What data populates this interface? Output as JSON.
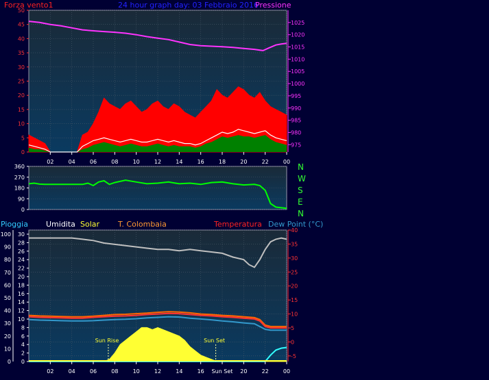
{
  "header": {
    "left_label": "Forza vento1",
    "title": "24 hour graph day: 03 Febbraio 2016",
    "right_label": "Pressione"
  },
  "bottom_header": {
    "pioggia": "Pioggia",
    "umidita": "Umidita",
    "solar": "Solar",
    "colombaia": "T. Colombaia",
    "temperatura": "Temperatura",
    "dewpoint": "Dew Point (°C)"
  },
  "x_ticks": [
    "02",
    "04",
    "06",
    "08",
    "10",
    "12",
    "14",
    "16",
    "18",
    "20",
    "22",
    "00"
  ],
  "bottom_x_ticks": [
    "02",
    "04",
    "06",
    "08",
    "10",
    "12",
    "14",
    "16",
    "Sun Set",
    "20",
    "22",
    "00"
  ],
  "colors": {
    "background": "#000033",
    "wind": "#ff0000",
    "wind_avg": "#ffffff",
    "gust_base": "#008000",
    "pressure": "#ff33ff",
    "direction": "#00ff00",
    "humidity": "#c0c0c0",
    "temperature": "#ff3333",
    "colombaia": "#ff6600",
    "dewpoint": "#3399cc",
    "solar": "#ffff33",
    "rain": "#33ffff"
  },
  "chart_data": [
    {
      "type": "area",
      "name": "wind-pressure",
      "xlim": [
        0,
        24
      ],
      "y_left": {
        "label": "Forza vento1",
        "lim": [
          0,
          50
        ],
        "ticks": [
          0,
          5,
          10,
          15,
          20,
          25,
          30,
          35,
          40,
          45,
          50
        ]
      },
      "y_right": {
        "label": "Pressione",
        "lim": [
          972,
          1030
        ],
        "ticks": [
          975,
          980,
          985,
          990,
          995,
          1000,
          1005,
          1010,
          1015,
          1020,
          1025
        ]
      },
      "pressure": {
        "x": [
          0,
          1,
          2,
          3,
          4,
          5,
          6,
          7,
          8,
          9,
          10,
          11,
          12,
          13,
          14,
          15,
          16,
          17,
          18,
          19,
          20,
          21,
          21.8,
          22.3,
          23,
          23.5,
          24
        ],
        "y": [
          1025.5,
          1025,
          1024.2,
          1023.6,
          1022.8,
          1022,
          1021.6,
          1021.3,
          1021,
          1020.6,
          1020,
          1019.2,
          1018.6,
          1018,
          1017,
          1016,
          1015.5,
          1015.3,
          1015.1,
          1014.8,
          1014.4,
          1014,
          1013.5,
          1014.5,
          1015.8,
          1016.2,
          1016.5
        ]
      },
      "wind_gust": {
        "x": [
          0,
          0.5,
          1,
          1.5,
          2,
          2.5,
          3,
          3.5,
          4,
          4.5,
          5,
          5.5,
          6,
          6.5,
          7,
          7.5,
          8,
          8.5,
          9,
          9.5,
          10,
          10.5,
          11,
          11.5,
          12,
          12.5,
          13,
          13.5,
          14,
          14.5,
          15,
          15.5,
          16,
          16.5,
          17,
          17.5,
          18,
          18.5,
          19,
          19.5,
          20,
          20.5,
          21,
          21.5,
          22,
          22.5,
          23,
          23.5,
          24
        ],
        "y": [
          6,
          5,
          4,
          3,
          0,
          0,
          0,
          0,
          0,
          0,
          6,
          7,
          10,
          14,
          19,
          17,
          16,
          15,
          17,
          18,
          16,
          14,
          15,
          17,
          18,
          16,
          15,
          17,
          16,
          14,
          13,
          12,
          14,
          16,
          18,
          22,
          20,
          19,
          21,
          23,
          22,
          20,
          19,
          21,
          18,
          16,
          15,
          14,
          13
        ]
      },
      "wind_avg": {
        "x": [
          0,
          0.5,
          1,
          1.5,
          2,
          2.5,
          3,
          3.5,
          4,
          4.5,
          5,
          5.5,
          6,
          6.5,
          7,
          7.5,
          8,
          8.5,
          9,
          9.5,
          10,
          10.5,
          11,
          11.5,
          12,
          12.5,
          13,
          13.5,
          14,
          14.5,
          15,
          15.5,
          16,
          16.5,
          17,
          17.5,
          18,
          18.5,
          19,
          19.5,
          20,
          20.5,
          21,
          21.5,
          22,
          22.5,
          23,
          23.5,
          24
        ],
        "y": [
          2.5,
          2,
          1.5,
          1,
          0,
          0,
          0,
          0,
          0,
          0,
          2,
          3,
          4,
          4.5,
          5,
          4.5,
          4,
          3.5,
          4,
          4.5,
          4,
          3.5,
          3.5,
          4,
          4.5,
          4,
          3.5,
          4,
          3.5,
          3,
          3,
          2.5,
          3,
          4,
          5,
          6,
          7,
          6.5,
          7,
          8,
          7.5,
          7,
          6.5,
          7,
          7.5,
          6,
          5,
          4.5,
          4
        ]
      },
      "wind_base": {
        "x": [
          0,
          0.5,
          1,
          1.5,
          2,
          2.5,
          3,
          3.5,
          4,
          4.5,
          5,
          5.5,
          6,
          6.5,
          7,
          7.5,
          8,
          8.5,
          9,
          9.5,
          10,
          10.5,
          11,
          11.5,
          12,
          12.5,
          13,
          13.5,
          14,
          14.5,
          15,
          15.5,
          16,
          16.5,
          17,
          17.5,
          18,
          18.5,
          19,
          19.5,
          20,
          20.5,
          21,
          21.5,
          22,
          22.5,
          23,
          23.5,
          24
        ],
        "y": [
          1.5,
          1,
          1,
          0.5,
          0,
          0,
          0,
          0,
          0,
          0,
          1,
          1.5,
          2.5,
          3,
          3.5,
          3,
          2.5,
          2,
          2.5,
          3,
          2.5,
          2,
          2,
          2.5,
          3,
          2.5,
          2,
          2.5,
          2,
          2,
          2,
          1.5,
          2,
          3,
          3.5,
          4.5,
          5.5,
          5,
          5.5,
          6,
          5.5,
          5.5,
          5,
          5.5,
          6,
          4.5,
          3.5,
          3,
          2.5
        ]
      }
    },
    {
      "type": "line",
      "name": "wind-direction",
      "xlim": [
        0,
        24
      ],
      "y_left": {
        "lim": [
          0,
          360
        ],
        "ticks": [
          0,
          90,
          180,
          270,
          360
        ]
      },
      "compass_labels": [
        "N",
        "W",
        "S",
        "E",
        "N"
      ],
      "direction": {
        "x": [
          0,
          0.5,
          1,
          1.5,
          2,
          3,
          4,
          5,
          5.5,
          6,
          6.5,
          7,
          7.5,
          8,
          9,
          10,
          11,
          12,
          13,
          14,
          15,
          16,
          17,
          18,
          19,
          20,
          21,
          21.5,
          22,
          22.5,
          23,
          23.5,
          24
        ],
        "y": [
          215,
          220,
          212,
          210,
          210,
          210,
          210,
          210,
          220,
          200,
          230,
          240,
          210,
          225,
          245,
          230,
          215,
          220,
          230,
          215,
          220,
          210,
          225,
          230,
          215,
          205,
          210,
          200,
          160,
          50,
          20,
          15,
          10
        ]
      }
    },
    {
      "type": "line",
      "name": "temperature-humidity",
      "xlim": [
        0,
        24
      ],
      "y_left_outer": {
        "label": "Pioggia",
        "lim": [
          0,
          100
        ],
        "ticks": [
          0,
          10,
          20,
          30,
          40,
          50,
          60,
          70,
          80,
          90,
          100
        ]
      },
      "y_left_inner": {
        "label": "Solar",
        "lim": [
          0,
          30
        ],
        "ticks": [
          0,
          2,
          4,
          6,
          8,
          10,
          12,
          14,
          16,
          18,
          20,
          22,
          24,
          26,
          28,
          30
        ]
      },
      "y_right": {
        "label": "Dew Point (°C)",
        "lim": [
          -7,
          40
        ],
        "ticks": [
          -5,
          0,
          5,
          10,
          15,
          20,
          25,
          30,
          35,
          40
        ]
      },
      "annotations": [
        {
          "text": "Sun Rise",
          "x": 7.4
        },
        {
          "text": "Sun Set",
          "x": 17.4
        }
      ],
      "humidity": {
        "x": [
          0,
          1,
          2,
          3,
          4,
          5,
          6,
          7,
          8,
          9,
          10,
          11,
          12,
          13,
          14,
          15,
          16,
          17,
          18,
          19,
          20,
          20.5,
          21,
          21.5,
          22,
          22.5,
          23,
          23.5,
          24
        ],
        "y": [
          97,
          97,
          97,
          97,
          97,
          96,
          95,
          93,
          92,
          91,
          90,
          89,
          88,
          88,
          87,
          88,
          87,
          86,
          85,
          82,
          80,
          76,
          74,
          80,
          88,
          94,
          96,
          97,
          96
        ]
      },
      "temperature": {
        "x": [
          0,
          1,
          2,
          3,
          4,
          5,
          6,
          7,
          8,
          9,
          10,
          11,
          12,
          13,
          14,
          15,
          16,
          17,
          18,
          19,
          20,
          21,
          21.5,
          22,
          22.5,
          23,
          24
        ],
        "y": [
          9,
          8.8,
          8.7,
          8.6,
          8.5,
          8.5,
          8.8,
          9,
          9.2,
          9.3,
          9.5,
          9.8,
          10,
          10.2,
          10.1,
          9.8,
          9.5,
          9.3,
          9,
          8.8,
          8.5,
          8.2,
          7.5,
          5.5,
          5,
          5,
          5
        ]
      },
      "colombaia": {
        "x": [
          0,
          1,
          2,
          3,
          4,
          5,
          6,
          7,
          8,
          9,
          10,
          11,
          12,
          13,
          14,
          15,
          16,
          17,
          18,
          19,
          20,
          21,
          21.5,
          22,
          22.5,
          23,
          24
        ],
        "y": [
          9.5,
          9.3,
          9.2,
          9.1,
          9,
          9,
          9.2,
          9.5,
          9.8,
          9.9,
          10.1,
          10.3,
          10.6,
          10.8,
          10.7,
          10.4,
          10,
          9.8,
          9.5,
          9.3,
          9,
          8.7,
          8,
          6,
          5.5,
          5.5,
          5.5
        ]
      },
      "dewpoint": {
        "x": [
          0,
          1,
          2,
          3,
          4,
          5,
          6,
          7,
          8,
          9,
          10,
          11,
          12,
          13,
          14,
          15,
          16,
          17,
          18,
          19,
          20,
          21,
          21.5,
          22,
          22.5,
          23,
          24
        ],
        "y": [
          8,
          7.8,
          7.7,
          7.6,
          7.5,
          7.5,
          7.6,
          7.8,
          8,
          8.1,
          8.3,
          8.6,
          8.8,
          9,
          8.9,
          8.5,
          8.2,
          7.9,
          7.5,
          7.2,
          6.8,
          6.5,
          5.5,
          4.5,
          4.2,
          4.2,
          4.2
        ]
      },
      "solar": {
        "x": [
          0,
          7,
          7.5,
          8,
          8.5,
          9,
          9.5,
          10,
          10.5,
          11,
          11.5,
          12,
          12.5,
          13,
          13.5,
          14,
          14.5,
          15,
          15.5,
          16,
          16.5,
          17,
          17.5,
          24
        ],
        "y": [
          0,
          0,
          0.5,
          2,
          4,
          5,
          6,
          7,
          8,
          8,
          7.5,
          8,
          7.5,
          7,
          6.5,
          6,
          5,
          3.5,
          2.5,
          1.5,
          1,
          0.5,
          0,
          0
        ]
      },
      "rain": {
        "x": [
          0,
          1,
          2,
          3,
          4,
          5,
          6,
          7,
          8,
          9,
          10,
          11,
          12,
          13,
          14,
          15,
          16,
          17,
          18,
          19,
          20,
          21,
          22,
          22.5,
          23,
          23.5,
          24
        ],
        "y": [
          0,
          0,
          0,
          0,
          0,
          0,
          0,
          0,
          0,
          0,
          0,
          0,
          0,
          0,
          0,
          0,
          0,
          0,
          0,
          0,
          0,
          0,
          0,
          5,
          9,
          10.5,
          11
        ]
      }
    }
  ]
}
